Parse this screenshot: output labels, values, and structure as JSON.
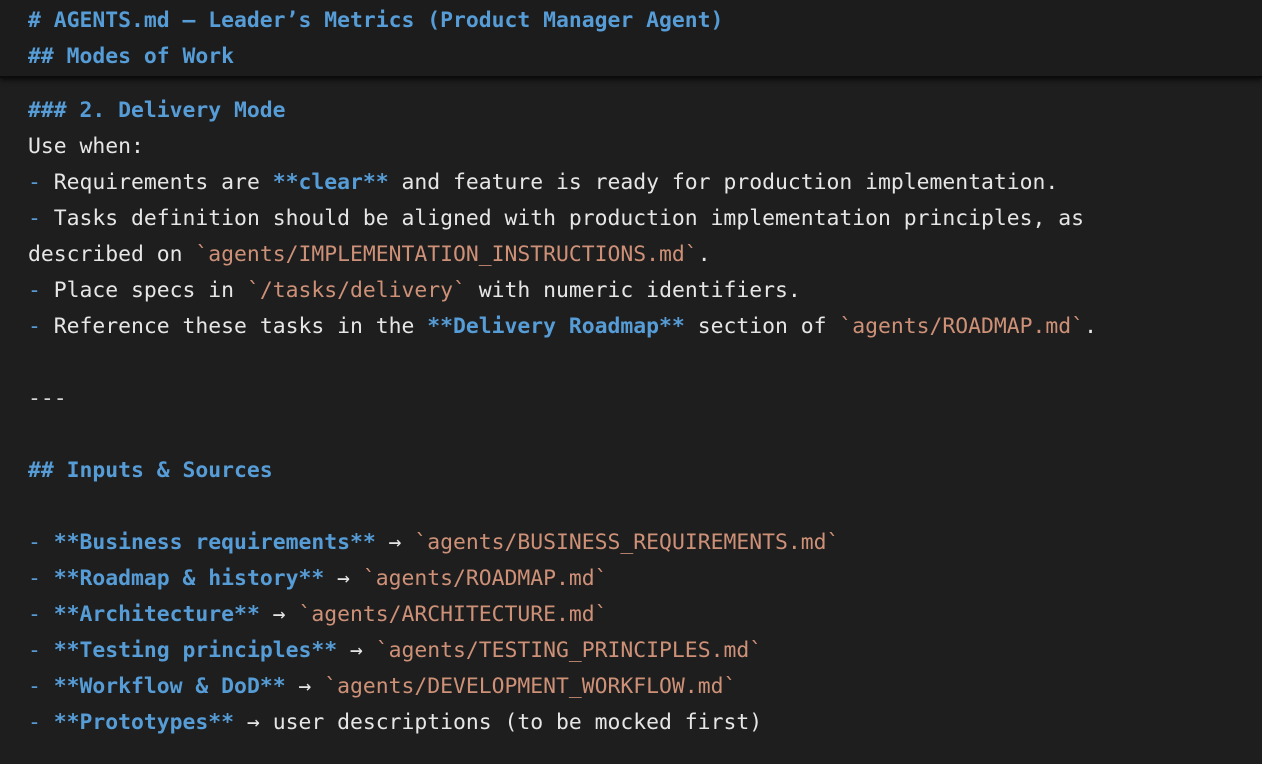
{
  "sticky": {
    "h1": "# AGENTS.md — Leader’s Metrics (Product Manager Agent)",
    "h2": "## Modes of Work"
  },
  "lines": {
    "h3": "### 2. Delivery Mode",
    "use_when": "Use when:",
    "l1": {
      "dash": "- ",
      "pre": "Requirements are ",
      "bold": "**clear**",
      "post": " and feature is ready for production implementation."
    },
    "l2": {
      "dash": "- ",
      "text": "Tasks definition should be aligned with production implementation principles, as"
    },
    "l3": {
      "pre": "described on ",
      "code": "`agents/IMPLEMENTATION_INSTRUCTIONS.md`",
      "post": "."
    },
    "l4": {
      "dash": "- ",
      "pre": "Place specs in ",
      "code": "`/tasks/delivery`",
      "post": " with numeric identifiers."
    },
    "l5": {
      "dash": "- ",
      "pre": "Reference these tasks in the ",
      "bold": "**Delivery Roadmap**",
      "mid": " section of ",
      "code": "`agents/ROADMAP.md`",
      "post": "."
    },
    "hr": "---",
    "h2_inputs": "## Inputs & Sources",
    "sources": [
      {
        "dash": "- ",
        "bold": "**Business requirements**",
        "arrow": " → ",
        "code": "`agents/BUSINESS_REQUIREMENTS.md`"
      },
      {
        "dash": "- ",
        "bold": "**Roadmap & history**",
        "arrow": " → ",
        "code": "`agents/ROADMAP.md`"
      },
      {
        "dash": "- ",
        "bold": "**Architecture**",
        "arrow": " → ",
        "code": "`agents/ARCHITECTURE.md`"
      },
      {
        "dash": "- ",
        "bold": "**Testing principles**",
        "arrow": " → ",
        "code": "`agents/TESTING_PRINCIPLES.md`"
      },
      {
        "dash": "- ",
        "bold": "**Workflow & DoD**",
        "arrow": " → ",
        "code": "`agents/DEVELOPMENT_WORKFLOW.md`"
      },
      {
        "dash": "- ",
        "bold": "**Prototypes**",
        "arrow": " → ",
        "text": "user descriptions (to be mocked first)"
      }
    ]
  }
}
